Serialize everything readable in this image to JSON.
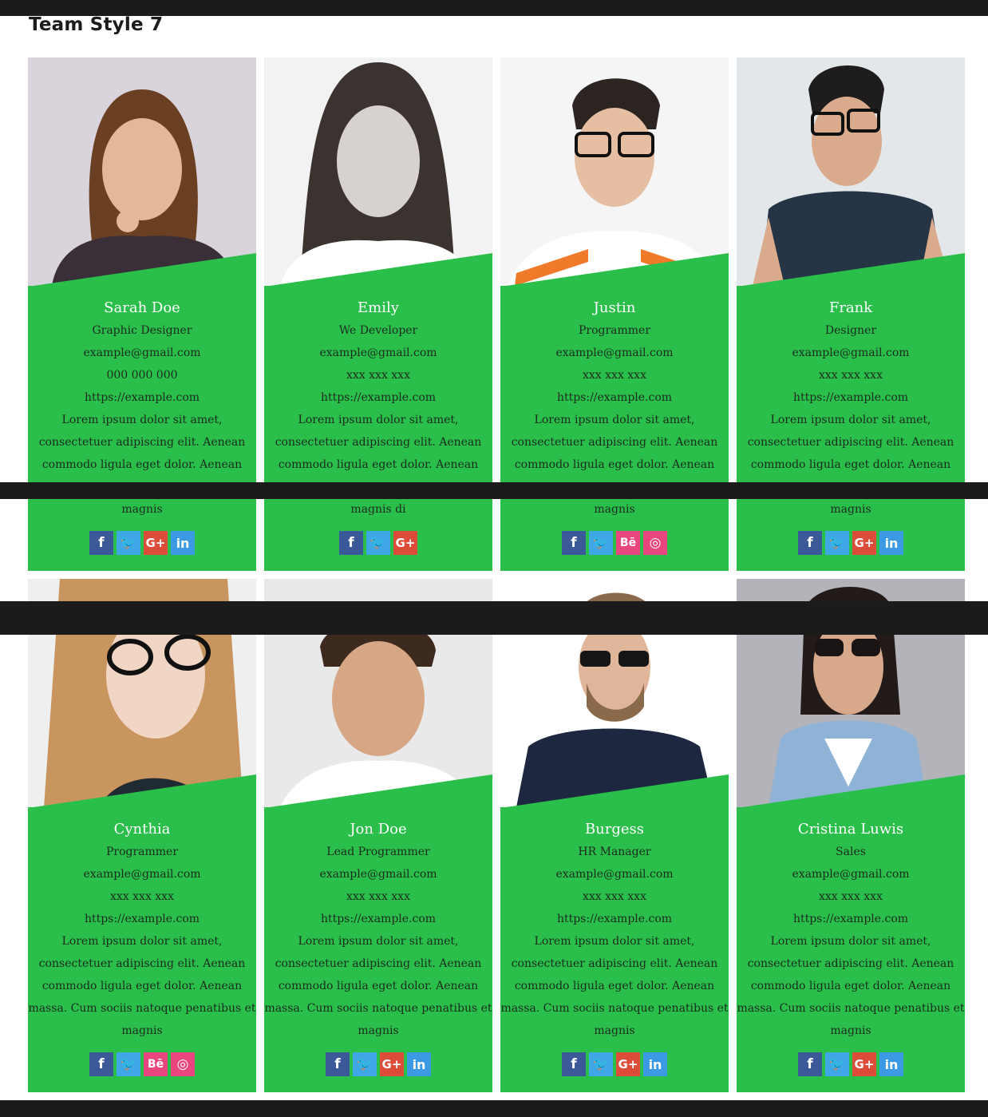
{
  "page_title": "Team Style 7",
  "colors": {
    "card_green": "#29bf4a",
    "dark_bar": "#1b1b1b",
    "facebook": "#3b5998",
    "twitter": "#3fa7e6",
    "google_plus": "#dd4b39",
    "linkedin": "#3c9ae5",
    "behance": "#e9457e",
    "dribbble": "#e9457e"
  },
  "social_glyphs": {
    "facebook": "f",
    "twitter": "🐦",
    "google_plus": "G+",
    "linkedin": "in",
    "behance": "Bē",
    "dribbble": "◎"
  },
  "members": [
    {
      "name": "Sarah Doe",
      "role": "Graphic Designer",
      "email": "example@gmail.com",
      "phone": "000 000 000",
      "website": "https://example.com",
      "desc_lines": [
        "Lorem ipsum dolor sit amet,",
        "consectetuer adipiscing elit. Aenean",
        "commodo ligula eget dolor. Aenean",
        "magnis"
      ],
      "socials": [
        "facebook",
        "twitter",
        "google_plus",
        "linkedin"
      ]
    },
    {
      "name": "Emily",
      "role": "We Developer",
      "email": "example@gmail.com",
      "phone": "xxx xxx xxx",
      "website": "https://example.com",
      "desc_lines": [
        "Lorem ipsum dolor sit amet,",
        "consectetuer adipiscing elit. Aenean",
        "commodo ligula eget dolor. Aenean",
        "magnis di"
      ],
      "socials": [
        "facebook",
        "twitter",
        "google_plus"
      ]
    },
    {
      "name": "Justin",
      "role": "Programmer",
      "email": "example@gmail.com",
      "phone": "xxx xxx xxx",
      "website": "https://example.com",
      "desc_lines": [
        "Lorem ipsum dolor sit amet,",
        "consectetuer adipiscing elit. Aenean",
        "commodo ligula eget dolor. Aenean",
        "magnis"
      ],
      "socials": [
        "facebook",
        "twitter",
        "behance",
        "dribbble"
      ]
    },
    {
      "name": "Frank",
      "role": "Designer",
      "email": "example@gmail.com",
      "phone": "xxx xxx xxx",
      "website": "https://example.com",
      "desc_lines": [
        "Lorem ipsum dolor sit amet,",
        "consectetuer adipiscing elit. Aenean",
        "commodo ligula eget dolor. Aenean",
        "magnis"
      ],
      "socials": [
        "facebook",
        "twitter",
        "google_plus",
        "linkedin"
      ]
    },
    {
      "name": "Cynthia",
      "role": "Programmer",
      "email": "example@gmail.com",
      "phone": "xxx xxx xxx",
      "website": "https://example.com",
      "desc_lines": [
        "Lorem ipsum dolor sit amet,",
        "consectetuer adipiscing elit. Aenean",
        "commodo ligula eget dolor. Aenean",
        "massa. Cum sociis natoque penatibus et",
        "magnis"
      ],
      "socials": [
        "facebook",
        "twitter",
        "behance",
        "dribbble"
      ]
    },
    {
      "name": "Jon Doe",
      "role": "Lead Programmer",
      "email": "example@gmail.com",
      "phone": "xxx xxx xxx",
      "website": "https://example.com",
      "desc_lines": [
        "Lorem ipsum dolor sit amet,",
        "consectetuer adipiscing elit. Aenean",
        "commodo ligula eget dolor. Aenean",
        "massa. Cum sociis natoque penatibus et",
        "magnis"
      ],
      "socials": [
        "facebook",
        "twitter",
        "google_plus",
        "linkedin"
      ]
    },
    {
      "name": "Burgess",
      "role": "HR Manager",
      "email": "example@gmail.com",
      "phone": "xxx xxx xxx",
      "website": "https://example.com",
      "desc_lines": [
        "Lorem ipsum dolor sit amet,",
        "consectetuer adipiscing elit. Aenean",
        "commodo ligula eget dolor. Aenean",
        "massa. Cum sociis natoque penatibus et",
        "magnis"
      ],
      "socials": [
        "facebook",
        "twitter",
        "google_plus",
        "linkedin"
      ]
    },
    {
      "name": "Cristina Luwis",
      "role": "Sales",
      "email": "example@gmail.com",
      "phone": "xxx xxx xxx",
      "website": "https://example.com",
      "desc_lines": [
        "Lorem ipsum dolor sit amet,",
        "consectetuer adipiscing elit. Aenean",
        "commodo ligula eget dolor. Aenean",
        "massa. Cum sociis natoque penatibus et",
        "magnis"
      ],
      "socials": [
        "facebook",
        "twitter",
        "google_plus",
        "linkedin"
      ]
    }
  ]
}
